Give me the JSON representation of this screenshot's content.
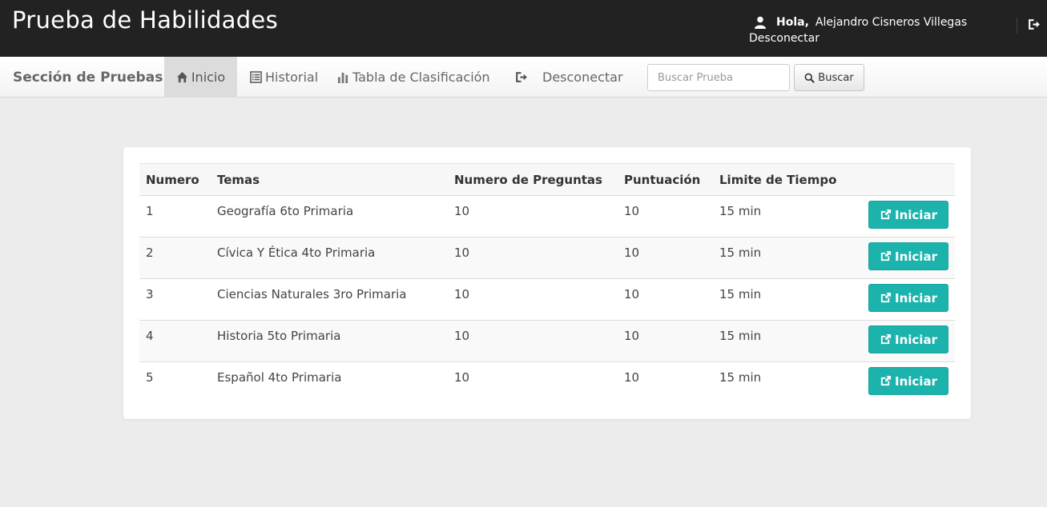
{
  "header": {
    "brand": "Prueba de Habilidades",
    "greeting": "Hola,",
    "user_name": "Alejandro Cisneros Villegas",
    "logout_link": "Desconectar",
    "icons": [
      "user-icon",
      "sign-out-icon"
    ]
  },
  "navbar": {
    "brand": "Sección de Pruebas",
    "items": [
      {
        "label": "Inicio",
        "icon": "home-icon",
        "active": true
      },
      {
        "label": "Historial",
        "icon": "list-icon",
        "active": false
      },
      {
        "label": "Tabla de Clasificación",
        "icon": "bar-chart-icon",
        "active": false
      },
      {
        "label": "Desconectar",
        "icon": "sign-out-icon",
        "active": false
      }
    ],
    "search_placeholder": "Buscar Prueba",
    "search_value": "",
    "search_button": "Buscar"
  },
  "table": {
    "columns": [
      "Numero",
      "Temas",
      "Numero de Preguntas",
      "Puntuación",
      "Limite de Tiempo"
    ],
    "rows": [
      {
        "numero": "1",
        "tema": "Geografía 6to Primaria",
        "preguntas": "10",
        "puntuacion": "10",
        "tiempo": "15 min",
        "action": "Iniciar"
      },
      {
        "numero": "2",
        "tema": "Cívica Y Ética 4to Primaria",
        "preguntas": "10",
        "puntuacion": "10",
        "tiempo": "15 min",
        "action": "Iniciar"
      },
      {
        "numero": "3",
        "tema": "Ciencias Naturales 3ro Primaria",
        "preguntas": "10",
        "puntuacion": "10",
        "tiempo": "15 min",
        "action": "Iniciar"
      },
      {
        "numero": "4",
        "tema": "Historia 5to Primaria",
        "preguntas": "10",
        "puntuacion": "10",
        "tiempo": "15 min",
        "action": "Iniciar"
      },
      {
        "numero": "5",
        "tema": "Español 4to Primaria",
        "preguntas": "10",
        "puntuacion": "10",
        "tiempo": "15 min",
        "action": "Iniciar"
      }
    ]
  },
  "colors": {
    "topbar": "#222222",
    "accent_button": "#1cb3ac",
    "page_background": "#ececec"
  }
}
